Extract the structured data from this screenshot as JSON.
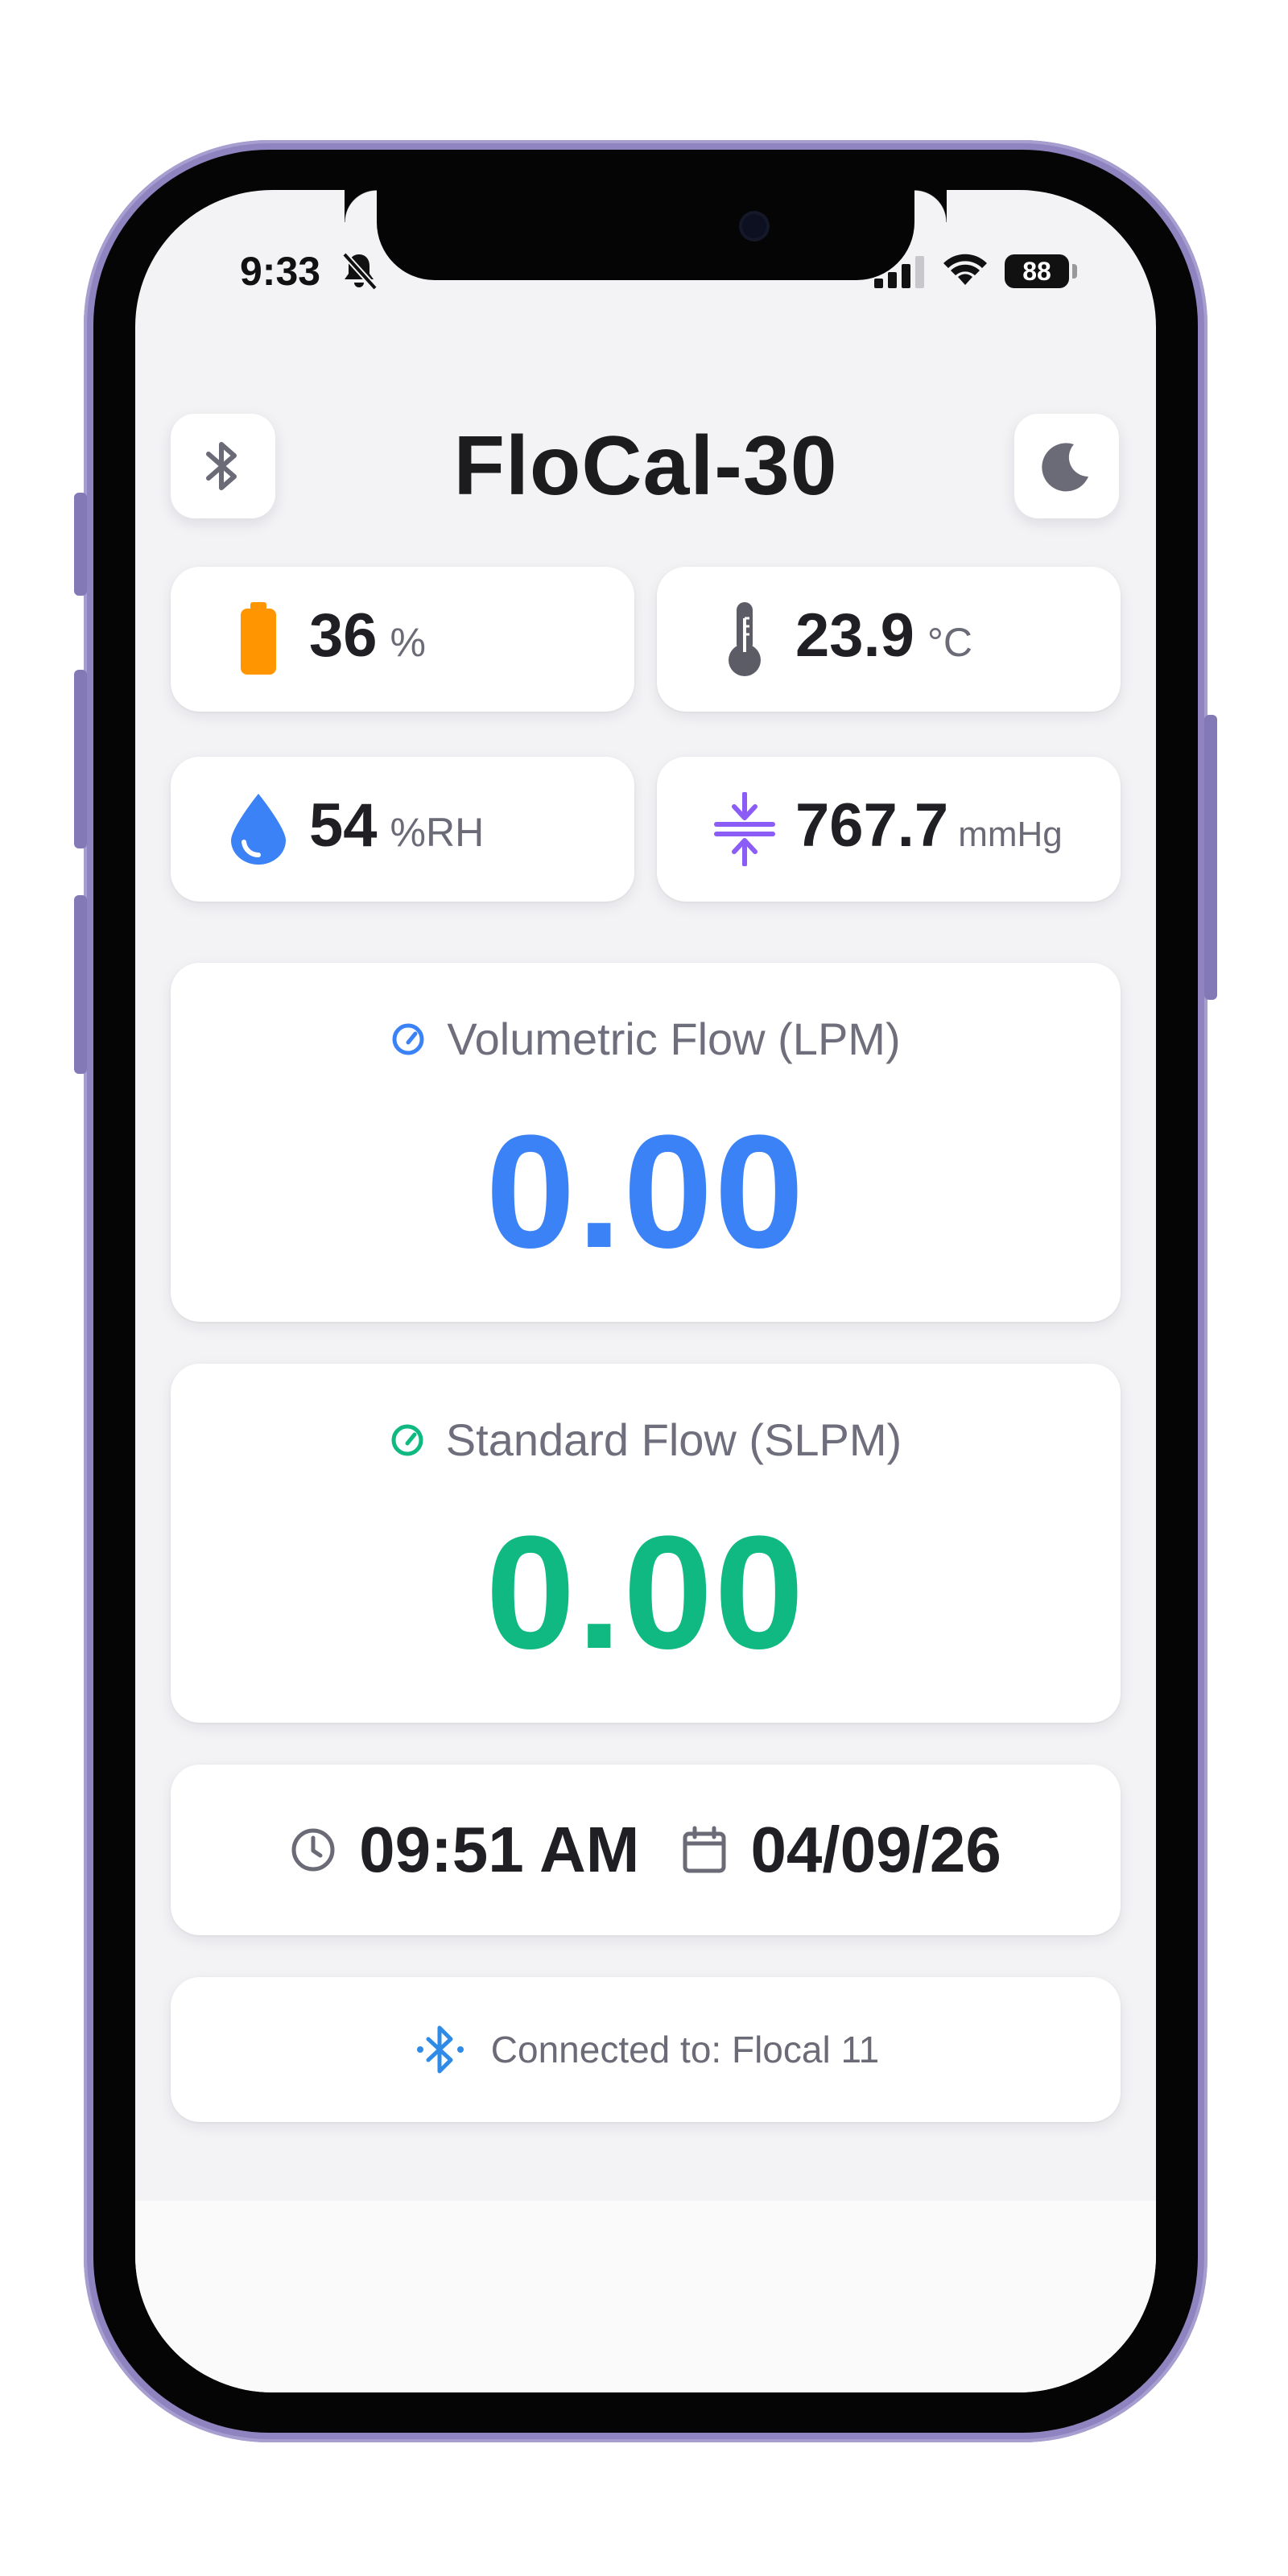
{
  "status_bar": {
    "time": "9:33",
    "battery_level": "88",
    "silent_icon": "bell-slash-icon",
    "signal_icon": "cellular-signal-icon",
    "wifi_icon": "wifi-icon"
  },
  "header": {
    "title": "FloCal-30",
    "left_button_icon": "bluetooth-icon",
    "right_button_icon": "moon-icon"
  },
  "metrics": {
    "battery": {
      "value": "36",
      "unit": "%",
      "icon": "battery-icon",
      "color": "#ff9500"
    },
    "temperature": {
      "value": "23.9",
      "unit": "°C",
      "icon": "thermometer-icon",
      "color": "#5c5c66"
    },
    "humidity": {
      "value": "54",
      "unit": "%RH",
      "icon": "droplet-icon",
      "color": "#3b82f6"
    },
    "pressure": {
      "value": "767.7",
      "unit": "mmHg",
      "icon": "compress-arrows-icon",
      "color": "#8b5cf6"
    }
  },
  "volumetric_flow": {
    "label": "Volumetric Flow (LPM)",
    "value": "0.00",
    "color": "#3b82f6",
    "icon": "gauge-icon"
  },
  "standard_flow": {
    "label": "Standard Flow (SLPM)",
    "value": "0.00",
    "color": "#10b981",
    "icon": "gauge-icon"
  },
  "datetime": {
    "time": "09:51 AM",
    "date": "04/09/26",
    "time_icon": "clock-icon",
    "date_icon": "calendar-icon"
  },
  "connection": {
    "text": "Connected to: Flocal 11",
    "icon": "bluetooth-connected-icon",
    "color": "#2f8be6"
  }
}
